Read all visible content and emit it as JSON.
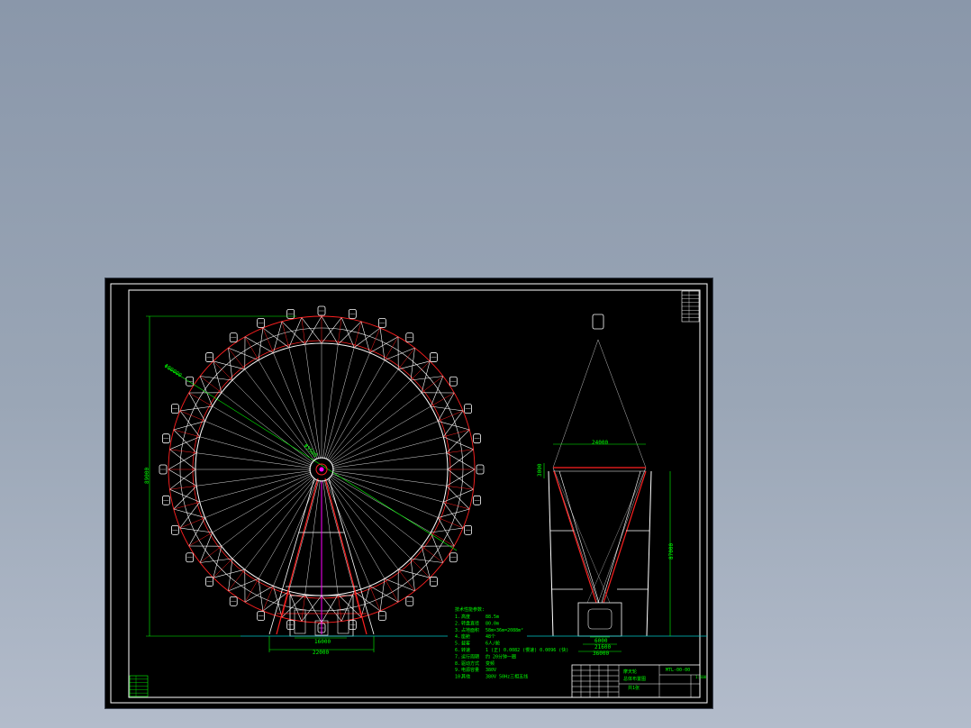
{
  "colors": {
    "background_top": "#8a97aa",
    "background_bottom": "#b3bccb",
    "sheet": "#000000",
    "frame": "#ffffff",
    "dimension": "#00ff00",
    "structure_red": "#ff2020",
    "structure_white": "#ffffff",
    "ground": "#00c8c8",
    "accent_magenta": "#ff00ff"
  },
  "front_view": {
    "dim_width_inner": "16000",
    "dim_width_outer": "22000",
    "dim_height": "89000",
    "dim_diameter_label": "Φ80000",
    "dim_radial_label": "Φ3500"
  },
  "side_view": {
    "dim_top_width": "24000",
    "dim_axle_height": "3000",
    "dim_tower_height": "87000",
    "dim_base_inner": "6000",
    "dim_base_mid": "21600",
    "dim_base_outer": "36000"
  },
  "notes": {
    "title": "技术性能参数:",
    "items": [
      {
        "no": "1.",
        "label": "高度",
        "value": "88.5m"
      },
      {
        "no": "2.",
        "label": "转盘直径",
        "value": "80.0m"
      },
      {
        "no": "3.",
        "label": "占地面积",
        "value": "58m×36m=2088m²"
      },
      {
        "no": "4.",
        "label": "座舱",
        "value": "48个"
      },
      {
        "no": "5.",
        "label": "载客",
        "value": "6人/舱"
      },
      {
        "no": "6.",
        "label": "转速",
        "value": "1 (正) 0.0082 (慢速) 0.0096 (快)"
      },
      {
        "no": "7.",
        "label": "运行周期",
        "value": "约 20分钟一圈"
      },
      {
        "no": "8.",
        "label": "驱动方式",
        "value": "变频"
      },
      {
        "no": "9.",
        "label": "电源容量",
        "value": "380V"
      },
      {
        "no": "10.",
        "label": "其他",
        "value": "380V 50Hz三相五线"
      }
    ]
  },
  "title_block": {
    "project": "摩天轮",
    "drawing_name": "总体布置图",
    "drawing_number": "MTL-00-00",
    "scale": "1:500",
    "sheet": "共1张"
  },
  "revision_table_rows": 8,
  "left_stamp_rows": 6
}
